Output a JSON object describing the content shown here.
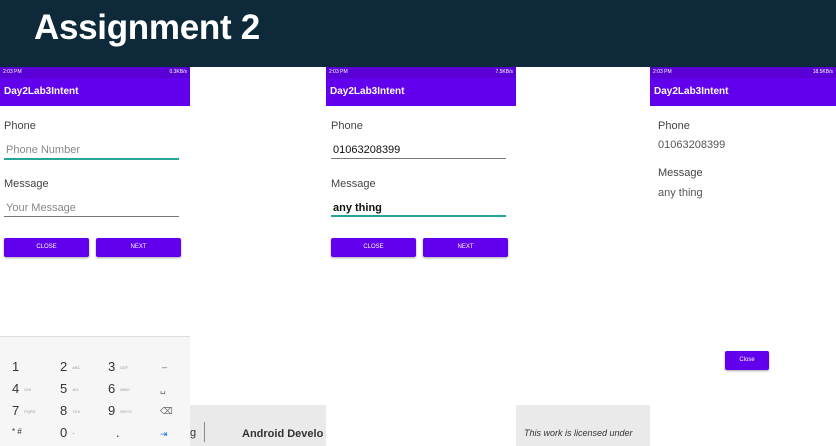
{
  "slide": {
    "title": "Assignment 2"
  },
  "background_footer": {
    "left_text": "g",
    "left_second": "Android Develo",
    "right_text": "This work is licensed under"
  },
  "phone1": {
    "status_time": "2:03 PM",
    "status_right": "0.3KB/s",
    "app_title": "Day2Lab3Intent",
    "phone_label": "Phone",
    "phone_placeholder": "Phone Number",
    "message_label": "Message",
    "message_placeholder": "Your Message",
    "close_button": "CLOSE",
    "next_button": "NEXT",
    "keypad": {
      "rows": [
        [
          {
            "digit": "1",
            "letters": ""
          },
          {
            "digit": "2",
            "letters": "ABC"
          },
          {
            "digit": "3",
            "letters": "DEF"
          }
        ],
        [
          {
            "digit": "4",
            "letters": "GHI"
          },
          {
            "digit": "5",
            "letters": "JKL"
          },
          {
            "digit": "6",
            "letters": "MNO"
          }
        ],
        [
          {
            "digit": "7",
            "letters": "PQRS"
          },
          {
            "digit": "8",
            "letters": "TUV"
          },
          {
            "digit": "9",
            "letters": "WXYZ"
          }
        ],
        [
          {
            "digit": "* #",
            "letters": ""
          },
          {
            "digit": "0",
            "letters": "+"
          },
          {
            "digit": ".",
            "letters": ""
          }
        ]
      ],
      "side_keys": [
        "–",
        "␣",
        "⌫",
        "⇥"
      ]
    }
  },
  "phone2": {
    "status_time": "2:03 PM",
    "status_right": "7.5KB/s",
    "app_title": "Day2Lab3Intent",
    "phone_label": "Phone",
    "phone_value": "01063208399",
    "message_label": "Message",
    "message_value": "any thing",
    "close_button": "CLOSE",
    "next_button": "NEXT"
  },
  "phone3": {
    "status_time": "2:03 PM",
    "status_right": "18.5KB/s",
    "app_title": "Day2Lab3Intent",
    "phone_label": "Phone",
    "phone_value": "01063208399",
    "message_label": "Message",
    "message_value": "any thing",
    "close_button": "Close"
  },
  "colors": {
    "title_bar": "#0e2a3a",
    "app_bar": "#6200ee",
    "status_bar": "#5a00d6",
    "accent_underline": "#26a69a"
  }
}
